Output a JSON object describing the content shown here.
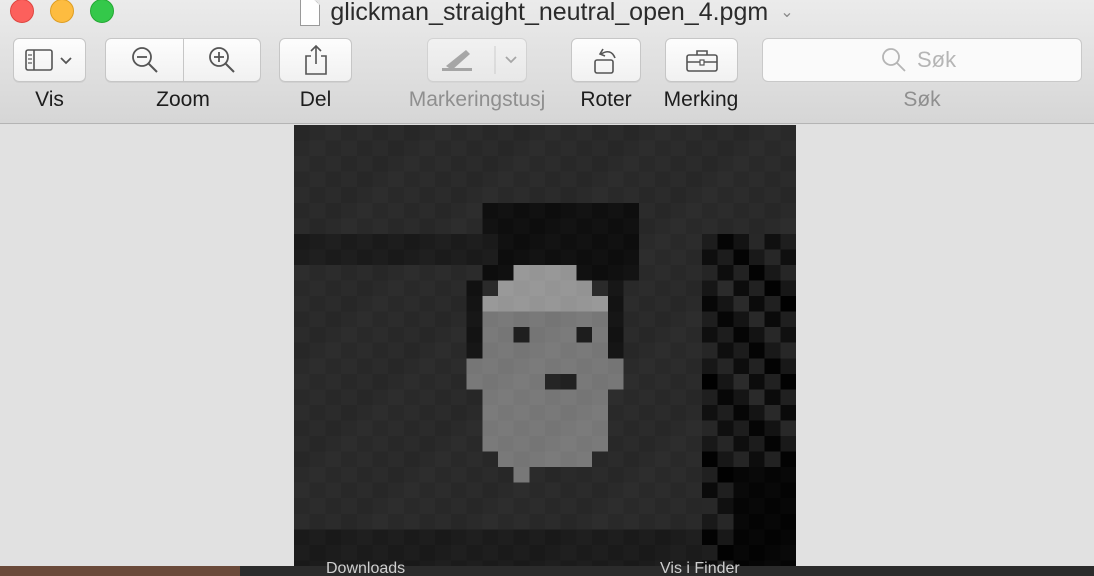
{
  "window": {
    "title": "glickman_straight_neutral_open_4.pgm"
  },
  "toolbar": {
    "view_label": "Vis",
    "zoom_label": "Zoom",
    "share_label": "Del",
    "highlight_label": "Markeringstusj",
    "rotate_label": "Roter",
    "markup_label": "Merking",
    "search_label": "Søk",
    "search_placeholder": "Søk"
  },
  "icons": {
    "view": "sidebar-icon",
    "zoom_out": "zoom-out-icon",
    "zoom_in": "zoom-in-icon",
    "share": "share-icon",
    "highlight": "highlighter-icon",
    "rotate": "rotate-icon",
    "markup": "toolbox-icon",
    "search": "search-icon"
  },
  "colors": {
    "close": "#fc605c",
    "minimize": "#fdbc40",
    "maximize": "#34c84a"
  },
  "background_strip": {
    "text_left": "Downloads",
    "text_right": "Vis i Finder"
  }
}
